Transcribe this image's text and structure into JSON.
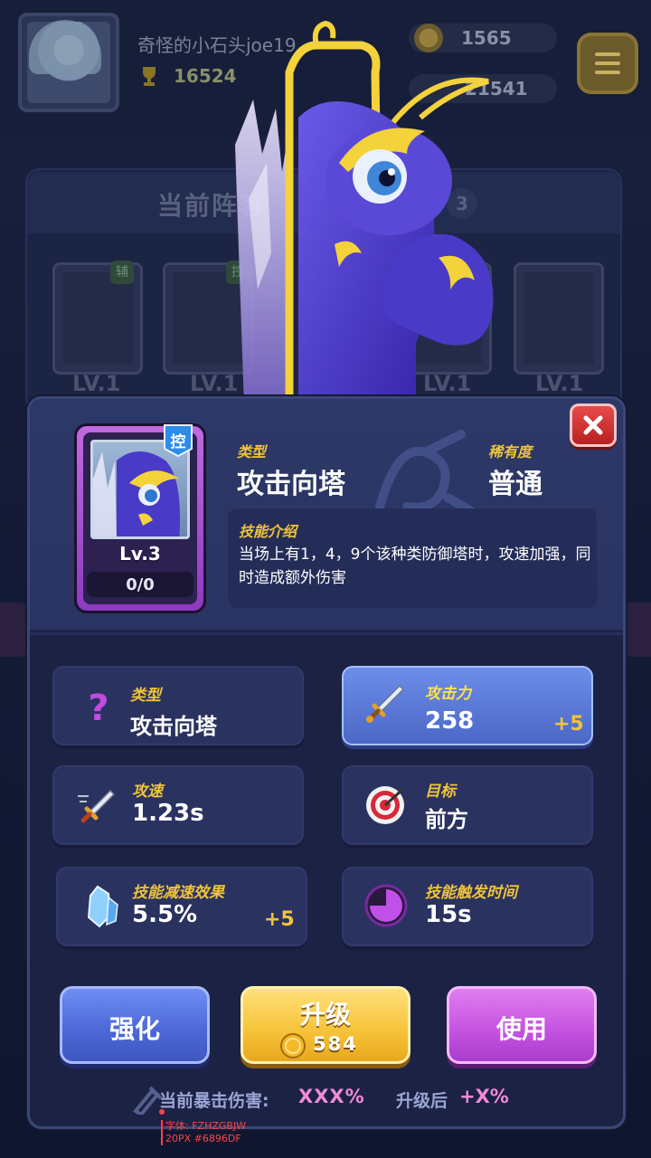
{
  "player": {
    "name": "奇怪的小石头joe19",
    "trophies": "16524",
    "coins": "1565",
    "gems": "21541"
  },
  "lineup": {
    "title": "当前阵容",
    "count": "3",
    "slots": [
      {
        "level": "LV.1",
        "tag": "辅"
      },
      {
        "level": "LV.1",
        "tag": "控"
      },
      {
        "level": "LV.1",
        "tag": ""
      },
      {
        "level": "LV.1",
        "tag": ""
      }
    ]
  },
  "detail": {
    "card": {
      "level": "Lv.3",
      "progress": "0/0",
      "badge": "控"
    },
    "type_label": "类型",
    "type_value": "攻击向塔",
    "rarity_label": "稀有度",
    "rarity_value": "普通",
    "skill_label": "技能介绍",
    "skill_desc": "当场上有1，4，9个该种类防御塔时，攻速加强，同时造成额外伤害"
  },
  "stats": {
    "type": {
      "label": "类型",
      "value": "攻击向塔",
      "icon": "question-icon"
    },
    "attack": {
      "label": "攻击力",
      "value": "258",
      "bonus": "+5",
      "icon": "sword-icon"
    },
    "speed": {
      "label": "攻速",
      "value": "1.23s",
      "icon": "speed-sword-icon"
    },
    "target": {
      "label": "目标",
      "value": "前方",
      "icon": "target-icon"
    },
    "slow": {
      "label": "技能减速效果",
      "value": "5.5%",
      "bonus": "+5",
      "icon": "ice-crystal-icon"
    },
    "trigger": {
      "label": "技能触发时间",
      "value": "15s",
      "icon": "timer-icon"
    }
  },
  "buttons": {
    "enhance": "强化",
    "upgrade": "升级",
    "upgrade_cost": "584",
    "use": "使用"
  },
  "crit": {
    "label": "当前暴击伤害:",
    "value": "XXX%",
    "after_label": "升级后",
    "after_value": "+X%"
  },
  "dev_note": {
    "line1": "字体: FZHZGBJW",
    "line2": "20PX #6896DF"
  },
  "colors": {
    "accent_yellow": "#f0c43a",
    "dialog_bg": "#252f5a",
    "highlight_blue": "#5a78d6",
    "button_purple": "#c451e0",
    "crit_pink": "#f08ad8"
  }
}
